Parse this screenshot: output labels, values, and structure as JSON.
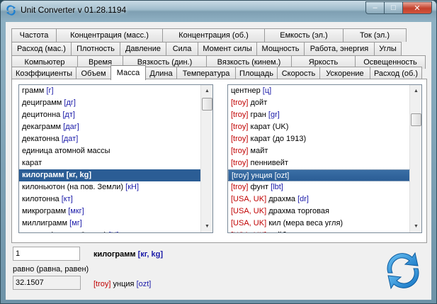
{
  "window": {
    "title": "Unit Converter v 01.28.1194",
    "minimize": "–",
    "maximize": "□",
    "close": "✕"
  },
  "tab_rows": [
    [
      {
        "label": "Частота",
        "w": 64
      },
      {
        "label": "Концентрация (масс.)",
        "w": 151
      },
      {
        "label": "Концентрация (об.)",
        "w": 145
      },
      {
        "label": "Емкость (эл.)",
        "w": 112
      },
      {
        "label": "Ток (эл.)",
        "w": 90
      }
    ],
    [
      {
        "label": "Расход (мас.)",
        "w": 85
      },
      {
        "label": "Плотность",
        "w": 70
      },
      {
        "label": "Давление",
        "w": 66
      },
      {
        "label": "Сила",
        "w": 46
      },
      {
        "label": "Момент силы",
        "w": 84
      },
      {
        "label": "Мощность",
        "w": 68
      },
      {
        "label": "Работа, энергия",
        "w": 100
      },
      {
        "label": "Углы",
        "w": 39
      }
    ],
    [
      {
        "label": "Компьютер",
        "w": 94
      },
      {
        "label": "Время",
        "w": 65
      },
      {
        "label": "Вязкость (дин.)",
        "w": 119
      },
      {
        "label": "Вязкость (кинем.)",
        "w": 121
      },
      {
        "label": "Яркость",
        "w": 91
      },
      {
        "label": "Освещенность",
        "w": 100
      }
    ],
    [
      {
        "label": "Коэффициенты",
        "w": 92
      },
      {
        "label": "Объем",
        "w": 50
      },
      {
        "label": "Масса",
        "w": 50,
        "active": true
      },
      {
        "label": "Длина",
        "w": 45
      },
      {
        "label": "Температура",
        "w": 84
      },
      {
        "label": "Площадь",
        "w": 60
      },
      {
        "label": "Скорость",
        "w": 61
      },
      {
        "label": "Ускорение",
        "w": 72
      },
      {
        "label": "Расход (об.)",
        "w": 74
      }
    ]
  ],
  "left_list": [
    {
      "name": "грамм",
      "unit": "[г]"
    },
    {
      "name": "дециграмм",
      "unit": "[дг]"
    },
    {
      "name": "децитонна",
      "unit": "[дт]"
    },
    {
      "name": "декаграмм",
      "unit": "[даг]"
    },
    {
      "name": "декатонна",
      "unit": "[дат]"
    },
    {
      "name": "единица атомной массы",
      "unit": ""
    },
    {
      "name": "карат",
      "unit": ""
    },
    {
      "name": "килограмм",
      "unit": "[кг, kg]",
      "selected": true
    },
    {
      "name": "килоньютон (на пов. Земли)",
      "unit": "[кН]"
    },
    {
      "name": "килотонна",
      "unit": "[кт]"
    },
    {
      "name": "микрограмм",
      "unit": "[мкг]"
    },
    {
      "name": "миллиграмм",
      "unit": "[мг]"
    },
    {
      "name": "ньютон (на пов. Земли)",
      "unit": "[Н]"
    }
  ],
  "right_list": [
    {
      "prefix": "",
      "name": "центнер",
      "unit": "[ц]"
    },
    {
      "prefix": "[troy]",
      "name": "дойт",
      "unit": ""
    },
    {
      "prefix": "[troy]",
      "name": "гран",
      "unit": "[gr]"
    },
    {
      "prefix": "[troy]",
      "name": "карат (UK)",
      "unit": ""
    },
    {
      "prefix": "[troy]",
      "name": "карат (до 1913)",
      "unit": ""
    },
    {
      "prefix": "[troy]",
      "name": "майт",
      "unit": ""
    },
    {
      "prefix": "[troy]",
      "name": "пеннивейт",
      "unit": ""
    },
    {
      "prefix": "[troy]",
      "name": "унция",
      "unit": "[ozt]",
      "selected": true
    },
    {
      "prefix": "[troy]",
      "name": "фунт",
      "unit": "[lbt]"
    },
    {
      "prefix": "[USA, UK]",
      "name": "драхма",
      "unit": "[dr]"
    },
    {
      "prefix": "[USA, UK]",
      "name": "драхма торговая",
      "unit": ""
    },
    {
      "prefix": "[USA, UK]",
      "name": "кил (мера веса угля)",
      "unit": ""
    },
    {
      "prefix": "[USA, UK]",
      "name": "дайбр",
      "unit": ""
    }
  ],
  "input_value": "1",
  "from_unit": {
    "name": "килограмм",
    "unit": "[кг, kg]"
  },
  "equals_label": "равно (равна, равен)",
  "result_value": "32.1507",
  "to_unit": {
    "prefix": "[troy]",
    "name": "унция",
    "unit": "[ozt]"
  },
  "colors": {
    "unit_blue": "#1a1aa8",
    "troy_red": "#c00000",
    "selection": "#2b5d95",
    "accent": "#1e8fd8"
  }
}
